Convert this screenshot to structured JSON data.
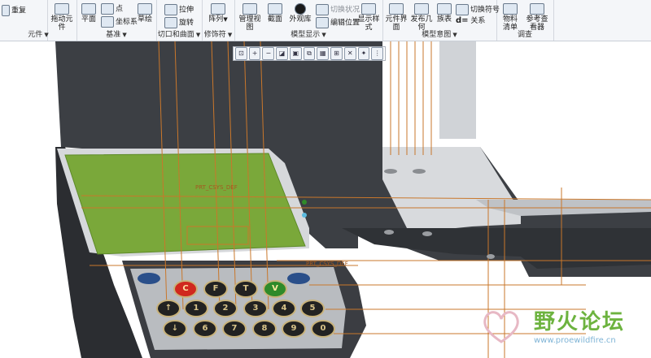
{
  "ribbon": {
    "redo_label": "重复",
    "drag_component_label": "拖动元件",
    "plane_label": "平面",
    "point_label": "点",
    "coord_sys_label": "坐标系",
    "sketch_label": "草绘",
    "extrude_label": "拉伸",
    "revolve_label": "旋转",
    "pattern_label": "阵列",
    "manage_views_label": "管理视图",
    "section_label": "截面",
    "appearance_label": "外观库",
    "switch_state_label": "切换状况",
    "edit_position_label": "编辑位置",
    "display_style_label": "显示样式",
    "component_interface_label": "元件界面",
    "publish_geometry_label": "发布几何",
    "family_table_label": "族表",
    "switch_symbol_label": "切换符号",
    "relations_label": "关系",
    "bom_label": "物料清单",
    "reference_viewer_label": "参考查看器",
    "groups": {
      "component": "元件",
      "datum": "基准",
      "cut_surface": "切口和曲面",
      "modifier": "修饰符",
      "model_display": "模型显示",
      "model_intent": "模型意图",
      "investigate": "调查"
    }
  },
  "viewport": {
    "csys_label_1": "PRT_CSYS_DEF",
    "csys_label_2": "PRT_CSYS_DEF",
    "keypad_row1": [
      "C",
      "F",
      "T",
      "V"
    ],
    "keypad_row2": [
      "1",
      "2",
      "3",
      "4",
      "5"
    ],
    "keypad_row3": [
      "6",
      "7",
      "8",
      "9",
      "0"
    ]
  },
  "watermark": {
    "title": "野火论坛",
    "url": "www.proewildfire.cn"
  },
  "colors": {
    "pcb_green": "#7aa83a",
    "housing_dark": "#3c3f44",
    "housing_light": "#d8dadd",
    "edge_orange": "#c9772b",
    "key_red": "#d0281e",
    "key_green": "#2f8a2a",
    "key_blue": "#2a4f8a",
    "watermark_green": "#6db33f"
  }
}
